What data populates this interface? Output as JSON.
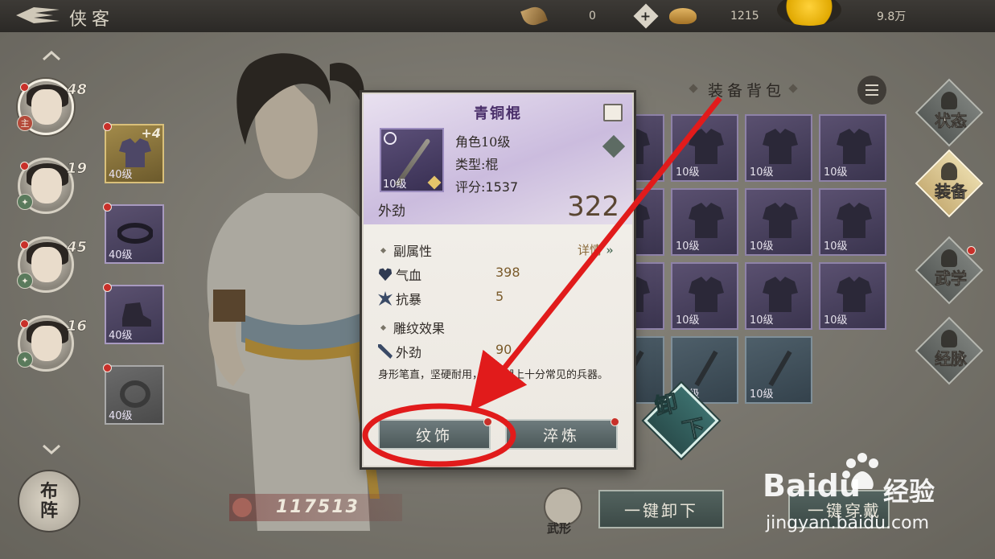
{
  "topbar": {
    "title": "侠客",
    "resources": [
      {
        "icon": "leaf-icon",
        "value": "0"
      },
      {
        "icon": "bowl-icon",
        "value": "1215"
      },
      {
        "icon": "coin-icon",
        "value": "9.8万"
      }
    ]
  },
  "heroes": [
    {
      "level": "48",
      "badge": "主",
      "active": true
    },
    {
      "level": "19",
      "badge": "",
      "active": false
    },
    {
      "level": "45",
      "badge": "",
      "active": false
    },
    {
      "level": "16",
      "badge": "",
      "active": false
    }
  ],
  "equip_slots": [
    {
      "level": "40级",
      "plus": "+4",
      "type": "robe"
    },
    {
      "level": "40级",
      "plus": "",
      "type": "belt"
    },
    {
      "level": "40级",
      "plus": "",
      "type": "boots"
    },
    {
      "level": "40级",
      "plus": "",
      "type": "ring"
    }
  ],
  "formation": {
    "line1": "布",
    "line2": "阵"
  },
  "power": {
    "value": "117513"
  },
  "bag": {
    "title": "装备背包",
    "items": [
      {
        "level": "10级"
      },
      {
        "level": "10级"
      },
      {
        "level": "10级"
      },
      {
        "level": "10级"
      },
      {
        "level": "10级"
      },
      {
        "level": "10级"
      },
      {
        "level": "10级"
      },
      {
        "level": "10级"
      },
      {
        "level": "10级"
      },
      {
        "level": "10级"
      },
      {
        "level": "10级"
      },
      {
        "level": "10级"
      },
      {
        "level": "10级"
      },
      {
        "level": "10级"
      },
      {
        "level": "10级"
      }
    ]
  },
  "right_nav": [
    {
      "label": "状态",
      "active": false
    },
    {
      "label": "装备",
      "active": true
    },
    {
      "label": "武学",
      "active": false
    },
    {
      "label": "经脉",
      "active": false
    }
  ],
  "bottom": {
    "wuxing_label": "武形",
    "unequip_all": "一键卸下",
    "equip_all": "一键穿戴"
  },
  "unload": {
    "char1": "卸",
    "char2": "下"
  },
  "popup": {
    "name": "青铜棍",
    "icon_level": "10级",
    "role_level": "角色10级",
    "type_label": "类型",
    "type_value": "棍",
    "score_label": "评分",
    "score_value": "1537",
    "main_attr": "外劲",
    "main_value": "322",
    "sub_title": "副属性",
    "detail": "详情",
    "sub_attrs": [
      {
        "name": "气血",
        "value": "398",
        "icon": "heart-icon"
      },
      {
        "name": "抗暴",
        "value": "5",
        "icon": "burst-icon"
      }
    ],
    "engrave_title": "雕纹效果",
    "engrave_attrs": [
      {
        "name": "外劲",
        "value": "90",
        "icon": "blade-icon"
      }
    ],
    "description": "身形笔直，坚硬耐用，乃江湖上十分常见的兵器。",
    "btn_engrave": "纹饰",
    "btn_refine": "淬炼"
  },
  "watermark": {
    "brand": "Baidu",
    "cn": "经验",
    "url": "jingyan.baidu.com"
  },
  "colors": {
    "annotation_red": "#e11b1b",
    "popup_name": "#4a2f6a",
    "red_dot": "#c8302a"
  }
}
